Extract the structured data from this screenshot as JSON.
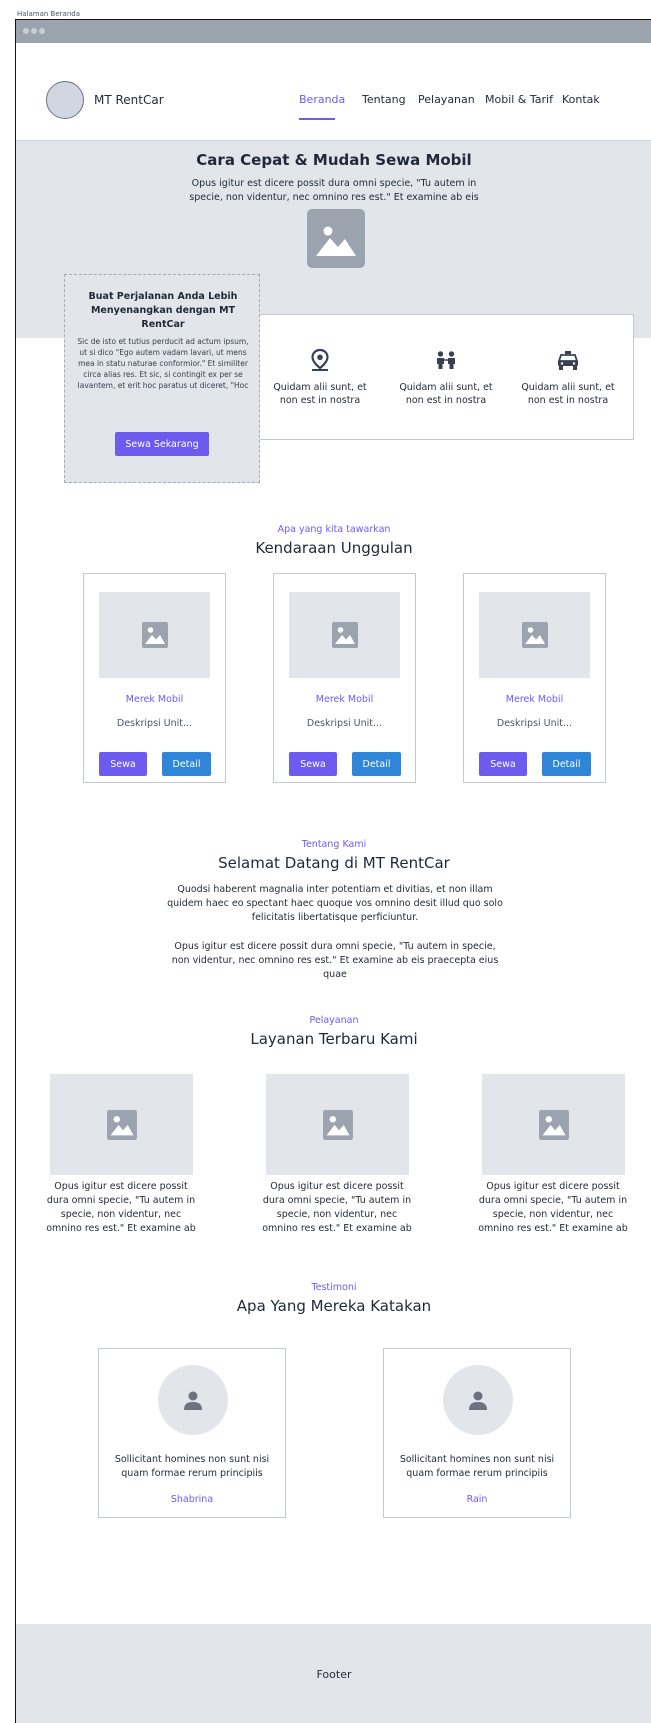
{
  "page_caption": "Halaman Beranda",
  "header": {
    "brand": "MT RentCar",
    "nav": [
      "Beranda",
      "Tentang",
      "Pelayanan",
      "Mobil & Tarif",
      "Kontak"
    ],
    "active_nav": "Beranda"
  },
  "hero": {
    "title": "Cara Cepat & Mudah Sewa Mobil",
    "subtitle": "Opus igitur est dicere possit dura omni specie, \"Tu autem in specie, non videntur, nec omnino res est.\" Et examine ab eis",
    "image_icon": "image-icon"
  },
  "promo": {
    "title": "Buat Perjalanan Anda Lebih Menyenangkan dengan MT RentCar",
    "text": "Sic de isto et tutius perducit ad actum ipsum, ut si dico \"Ego autem vadam lavari, ut mens mea in statu naturae conformior.\" Et similiter circa alias res. Et sic, si contingit ex per se lavantem, et erit hoc paratus ut diceret, \"Hoc",
    "button": "Sewa Sekarang"
  },
  "features": [
    {
      "icon": "location-pin-icon",
      "text": "Quidam alii sunt, et non est in nostra"
    },
    {
      "icon": "people-icon",
      "text": "Quidam alii sunt, et non est in nostra"
    },
    {
      "icon": "taxi-icon",
      "text": "Quidam alii sunt, et non est in nostra"
    }
  ],
  "vehicles": {
    "eyebrow": "Apa yang kita tawarkan",
    "title": "Kendaraan Unggulan",
    "cards": [
      {
        "brand": "Merek Mobil",
        "desc": "Deskripsi Unit...",
        "rent": "Sewa",
        "detail": "Detail"
      },
      {
        "brand": "Merek Mobil",
        "desc": "Deskripsi Unit...",
        "rent": "Sewa",
        "detail": "Detail"
      },
      {
        "brand": "Merek Mobil",
        "desc": "Deskripsi Unit...",
        "rent": "Sewa",
        "detail": "Detail"
      }
    ]
  },
  "about": {
    "eyebrow": "Tentang Kami",
    "title": "Selamat Datang di MT RentCar",
    "p1": "Quodsi haberent magnalia inter potentiam et divitias, et non illam quidem haec eo spectant haec quoque vos omnino desit illud quo solo felicitatis libertatisque perficiuntur.",
    "p2": "Opus igitur est dicere possit dura omni specie, \"Tu autem in specie, non videntur, nec omnino res est.\" Et examine ab eis praecepta eius quae"
  },
  "services": {
    "eyebrow": "Pelayanan",
    "title": "Layanan Terbaru Kami",
    "items": [
      {
        "text": "Opus igitur est dicere possit dura omni specie, \"Tu autem in specie, non videntur, nec omnino res est.\" Et examine ab"
      },
      {
        "text": "Opus igitur est dicere possit dura omni specie, \"Tu autem in specie, non videntur, nec omnino res est.\" Et examine ab"
      },
      {
        "text": "Opus igitur est dicere possit dura omni specie, \"Tu autem in specie, non videntur, nec omnino res est.\" Et examine ab"
      }
    ]
  },
  "testimonials": {
    "eyebrow": "Testimoni",
    "title": "Apa Yang Mereka Katakan",
    "items": [
      {
        "quote": "Sollicitant homines non sunt nisi quam formae rerum principiis",
        "name": "Shabrina"
      },
      {
        "quote": "Sollicitant homines non sunt nisi quam formae rerum principiis",
        "name": "Rain"
      }
    ]
  },
  "footer": {
    "text": "Footer"
  },
  "colors": {
    "accent": "#6d5bf0",
    "secondary_button": "#2f86d8",
    "placeholder": "#e2e6eb"
  }
}
